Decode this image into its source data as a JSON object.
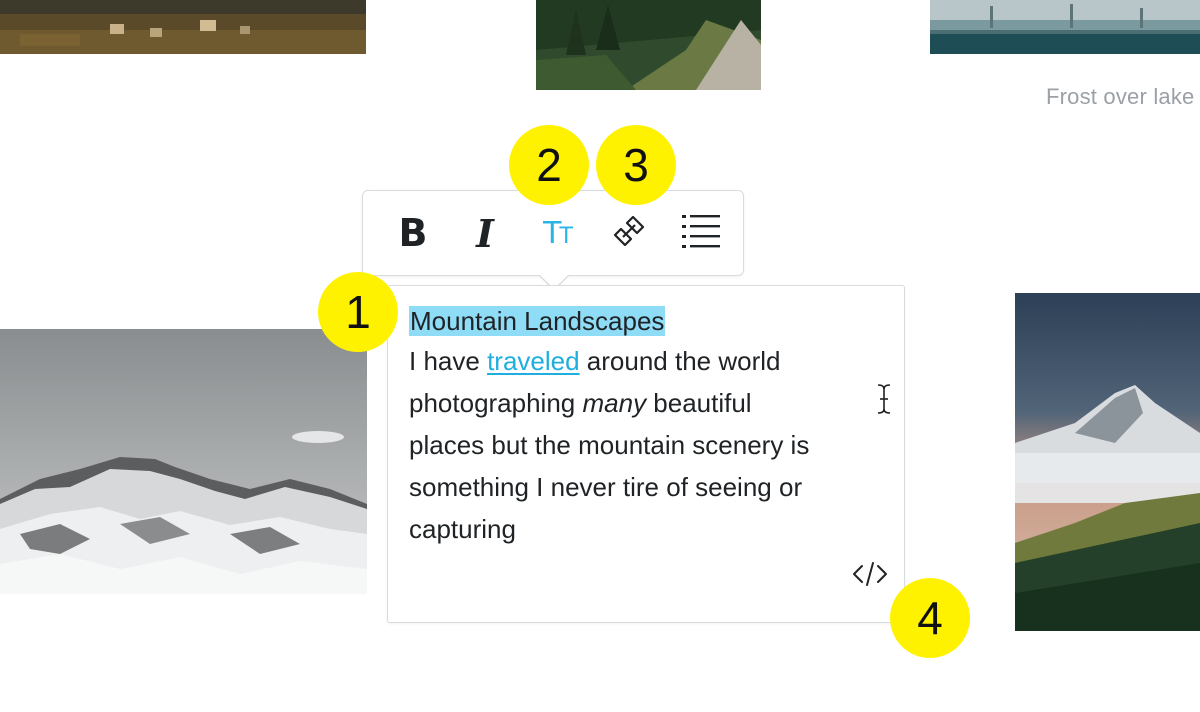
{
  "gallery": {
    "caption_lake": "Frost over lake"
  },
  "toolbar": {
    "bold_label": "B",
    "italic_label": "I",
    "size_label_big": "T",
    "size_label_small": "T",
    "buttons": [
      "bold-icon",
      "italic-icon",
      "text-size-icon",
      "unlink-icon",
      "list-icon"
    ],
    "active_color": "#29b6e6"
  },
  "editor": {
    "heading": "Mountain Landscapes",
    "line1_before": "I have ",
    "line1_link": "traveled",
    "line1_after": " around the world",
    "line2_before": "photographing ",
    "line2_em": "many",
    "line2_after": " beautiful",
    "line3": "places but the mountain scenery is",
    "line4": "something I never tire of seeing or",
    "line5": "capturing",
    "highlight_color": "#8fdcf7",
    "link_color": "#1eaee0"
  },
  "annotations": {
    "badge_1": "1",
    "badge_2": "2",
    "badge_3": "3",
    "badge_4": "4",
    "badge_color": "#fff200"
  }
}
